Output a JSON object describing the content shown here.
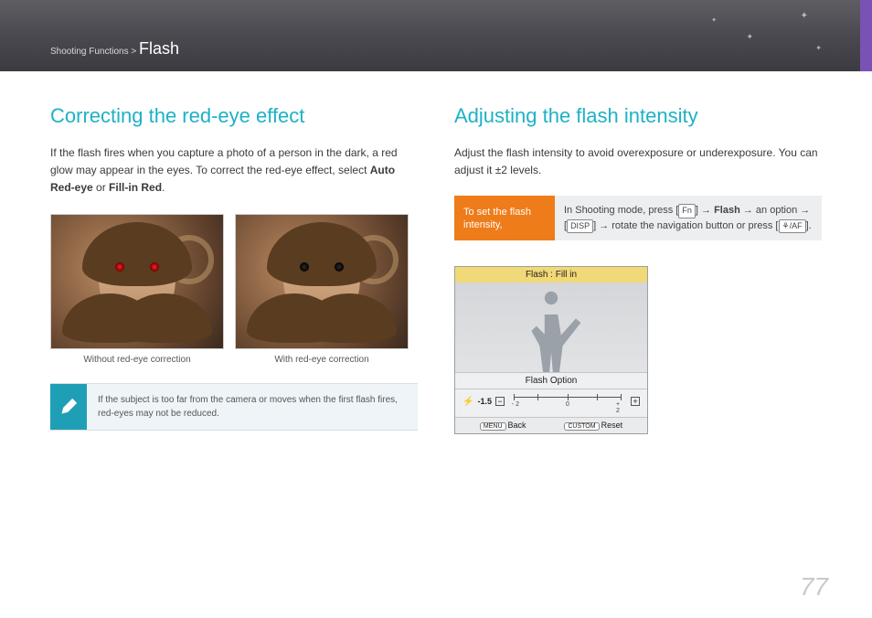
{
  "breadcrumb": {
    "section": "Shooting Functions",
    "separator": " > ",
    "page": "Flash"
  },
  "page_number": "77",
  "left": {
    "heading": "Correcting the red-eye effect",
    "para_pre": "If the flash fires when you capture a photo of a person in the dark, a red glow may appear in the eyes. To correct the red-eye effect, select ",
    "opt1": "Auto Red-eye",
    "or": " or ",
    "opt2": "Fill-in Red",
    "period": ".",
    "caption_left": "Without red-eye correction",
    "caption_right": "With red-eye correction",
    "note": "If the subject is too far from the camera or moves when the first flash fires, red-eyes may not be reduced."
  },
  "right": {
    "heading": "Adjusting the flash intensity",
    "para": "Adjust the flash intensity to avoid overexposure or underexposure. You can adjust it ±2 levels.",
    "instr_label": "To set the flash intensity,",
    "instr_steps": {
      "pre": "In Shooting mode, press [",
      "btn_fn": "Fn",
      "arrow": "→",
      "flash_word": "Flash",
      "an_option": "an option",
      "btn_disp": "DISP",
      "rotate": "rotate the navigation button or press [",
      "btn_af": "⚘/AF",
      "end": "]."
    },
    "lcd": {
      "title": "Flash : Fill in",
      "option_label": "Flash Option",
      "value": "-1.5",
      "scale_min": "- 2",
      "scale_mid": "0",
      "scale_max": "+ 2",
      "back_btn": "MENU",
      "back_label": "Back",
      "reset_btn": "CUSTOM",
      "reset_label": "Reset"
    }
  }
}
